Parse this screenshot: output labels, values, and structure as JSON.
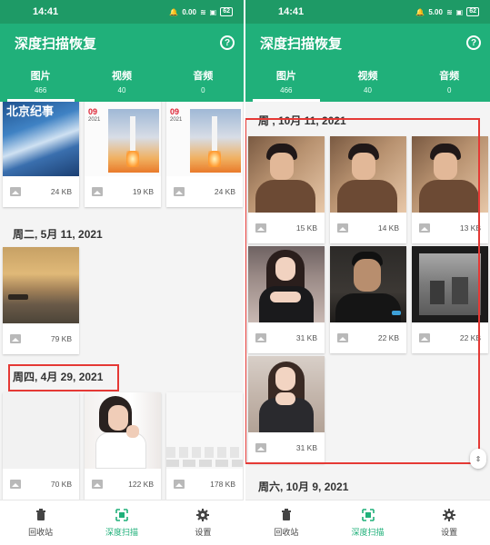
{
  "status_bar": {
    "time": "14:41",
    "net_speed_left": "0.00",
    "net_speed_right": "5.00",
    "net_unit": "KB/S",
    "battery": "62"
  },
  "app": {
    "title": "深度扫描恢复",
    "help_icon": "?"
  },
  "tabs": [
    {
      "label": "图片",
      "count": "466"
    },
    {
      "label": "视频",
      "count": "40"
    },
    {
      "label": "音频",
      "count": "0"
    }
  ],
  "left_screen": {
    "groups": [
      {
        "date": "",
        "items": [
          {
            "size": "24 KB"
          },
          {
            "size": "19 KB"
          },
          {
            "size": "24 KB"
          }
        ]
      },
      {
        "date": "周二, 5月 11, 2021",
        "items": [
          {
            "size": "79 KB"
          }
        ]
      },
      {
        "date": "周四, 4月 29, 2021",
        "items": [
          {
            "size": "70 KB"
          },
          {
            "size": "122 KB"
          },
          {
            "size": "178 KB"
          }
        ]
      }
    ],
    "thumb_text": {
      "newspaper_title": "北京纪事",
      "calendar_month": "09",
      "calendar_year": "2021",
      "calendar_num": "3.0"
    }
  },
  "right_screen": {
    "groups": [
      {
        "date": "周 , 10月 11, 2021",
        "items": [
          {
            "size": "15 KB"
          },
          {
            "size": "14 KB"
          },
          {
            "size": "13 KB"
          },
          {
            "size": "31 KB"
          },
          {
            "size": "22 KB"
          },
          {
            "size": "22 KB"
          },
          {
            "size": "31 KB"
          }
        ]
      },
      {
        "date": "周六, 10月 9, 2021",
        "items": []
      }
    ]
  },
  "bottom_nav": [
    {
      "label": "回收站",
      "icon": "trash-icon"
    },
    {
      "label": "深度扫描",
      "icon": "scan-icon"
    },
    {
      "label": "设置",
      "icon": "gear-icon"
    }
  ],
  "colors": {
    "primary": "#20b07a",
    "status_bar": "#1e9a66",
    "highlight_box": "#e53935"
  }
}
